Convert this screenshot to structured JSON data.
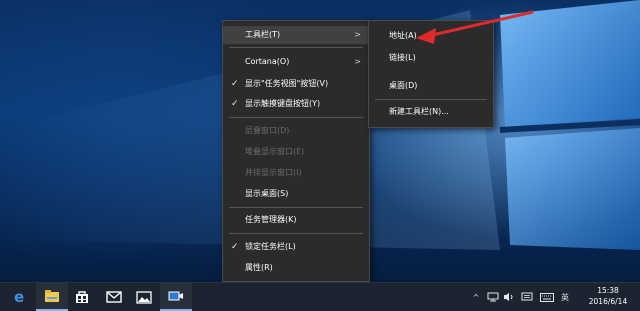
{
  "context_menu": {
    "items": [
      {
        "label": "工具栏(T)"
      },
      {
        "label": "Cortana(O)"
      },
      {
        "label": "显示\"任务视图\"按钮(V)"
      },
      {
        "label": "显示触摸键盘按钮(Y)"
      },
      {
        "label": "层叠窗口(D)"
      },
      {
        "label": "堆叠显示窗口(E)"
      },
      {
        "label": "并排显示窗口(I)"
      },
      {
        "label": "显示桌面(S)"
      },
      {
        "label": "任务管理器(K)"
      },
      {
        "label": "锁定任务栏(L)"
      },
      {
        "label": "属性(R)"
      }
    ]
  },
  "toolbar_submenu": {
    "items": [
      {
        "label": "地址(A)"
      },
      {
        "label": "链接(L)"
      },
      {
        "label": "桌面(D)"
      },
      {
        "label": "新建工具栏(N)..."
      }
    ]
  },
  "annotation": {
    "arrow_color": "#e02a2a"
  },
  "taskbar": {
    "pinned": [
      {
        "name": "edge-icon"
      },
      {
        "name": "file-explorer-icon"
      },
      {
        "name": "store-icon"
      },
      {
        "name": "mail-icon"
      },
      {
        "name": "photos-icon"
      },
      {
        "name": "video-icon"
      }
    ],
    "tray": {
      "chevron": "^",
      "ime": "英"
    },
    "clock": {
      "time": "15:38",
      "date": "2016/6/14"
    }
  }
}
